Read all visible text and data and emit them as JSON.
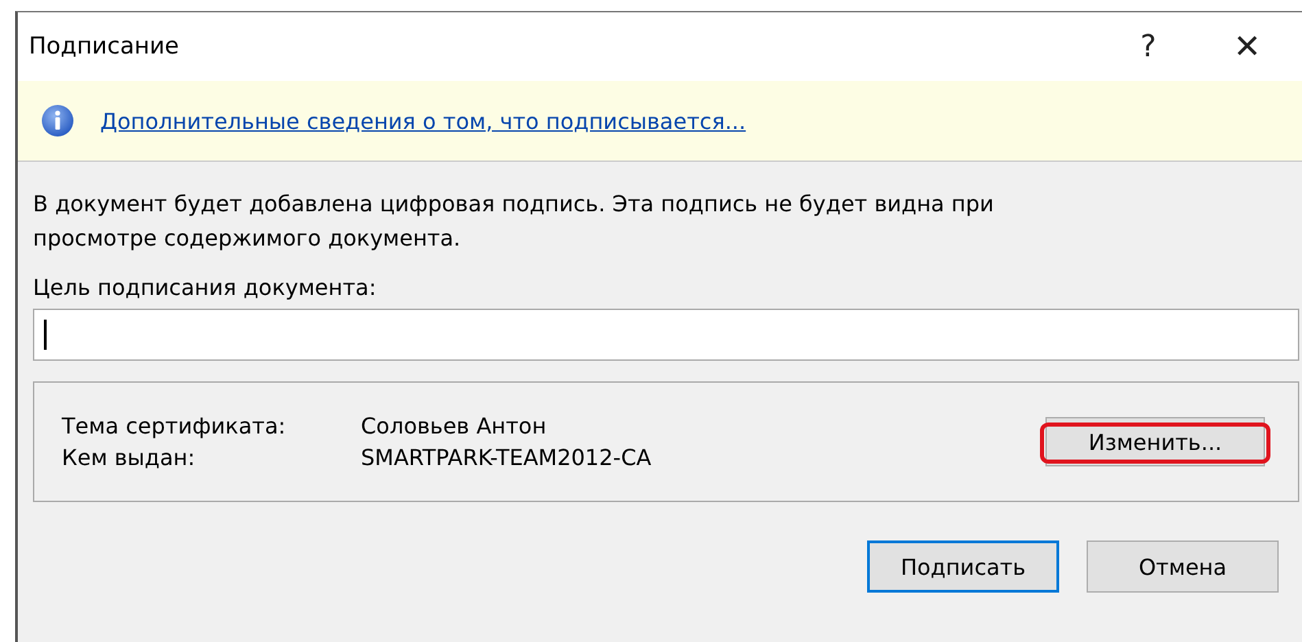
{
  "window": {
    "title": "Подписание",
    "help": "?",
    "close": "✕"
  },
  "info_bar": {
    "link": "Дополнительные сведения о том, что подписывается..."
  },
  "description": "В документ будет добавлена цифровая подпись. Эта подпись не будет видна при просмотре содержимого документа.",
  "purpose": {
    "label": "Цель подписания документа:"
  },
  "certificate": {
    "rows": [
      {
        "label": "Тема сертификата:",
        "value": "Соловьев Антон"
      },
      {
        "label": "Кем выдан:",
        "value": "SMARTPARK-TEAM2012-CA"
      }
    ],
    "change_button": {
      "label": "Изменить...",
      "highlighted": true
    }
  },
  "buttons": [
    {
      "label": "Подписать",
      "default": true
    },
    {
      "label": "Отмена",
      "default": false
    }
  ]
}
